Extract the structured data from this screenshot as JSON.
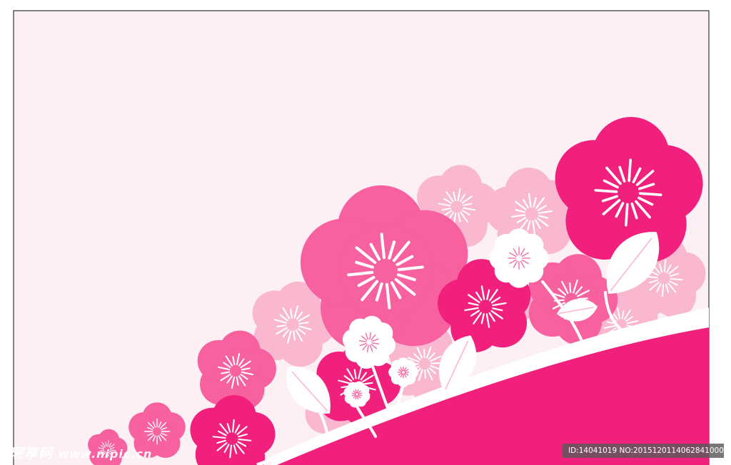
{
  "colors": {
    "page": "#ffffff",
    "card_fill": "#fdf0f5",
    "card_border": "#333333",
    "flower_light": "#f9b8d0",
    "flower_mid": "#f7619f",
    "flower_deep": "#f1207c",
    "hill": "#f1207c",
    "white": "#ffffff"
  },
  "icons": {
    "flower": "flower-icon",
    "leaf": "leaf-icon"
  },
  "watermark": {
    "brand": "昵享网",
    "site": "www.nipic.cn",
    "id_text": "ID:14041019 NO:20151201140628410000"
  }
}
